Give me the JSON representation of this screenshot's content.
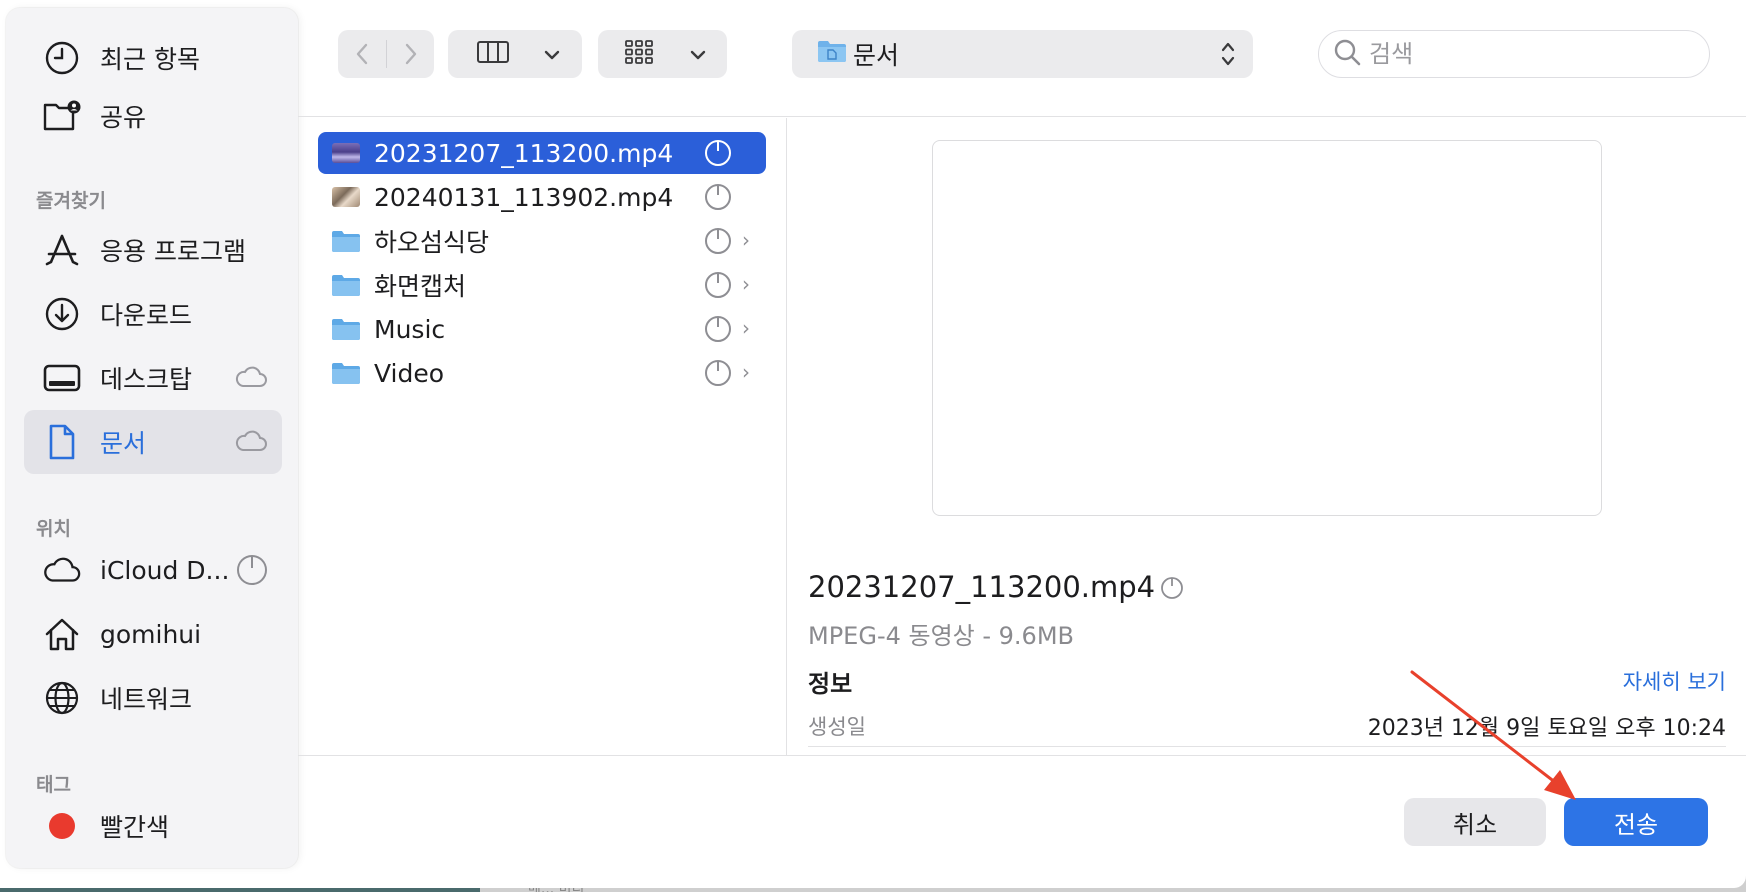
{
  "sidebar": {
    "recent": "최근 항목",
    "shared": "공유",
    "favorites_header": "즐겨찾기",
    "favorites": [
      {
        "label": "응용 프로그램"
      },
      {
        "label": "다운로드"
      },
      {
        "label": "데스크탑"
      },
      {
        "label": "문서"
      }
    ],
    "locations_header": "위치",
    "locations": [
      {
        "label": "iCloud D..."
      },
      {
        "label": "gomihui"
      },
      {
        "label": "네트워크"
      }
    ],
    "tags_header": "태그",
    "tags": [
      {
        "label": "빨간색",
        "color": "#e93a2e"
      }
    ]
  },
  "toolbar": {
    "location": "문서",
    "search_placeholder": "검색"
  },
  "files": [
    {
      "name": "20231207_113200.mp4",
      "kind": "video",
      "selected": true
    },
    {
      "name": "20240131_113902.mp4",
      "kind": "video",
      "selected": false
    },
    {
      "name": "하오섬식당",
      "kind": "folder",
      "selected": false
    },
    {
      "name": "화면캡처",
      "kind": "folder",
      "selected": false
    },
    {
      "name": "Music",
      "kind": "folder",
      "selected": false
    },
    {
      "name": "Video",
      "kind": "folder",
      "selected": false
    }
  ],
  "preview": {
    "title": "20231207_113200.mp4",
    "subtitle": "MPEG-4 동영상 - 9.6MB",
    "info_header": "정보",
    "more_link": "자세히 보기",
    "created_label": "생성일",
    "created_value": "2023년 12월 9일 토요일 오후 10:24"
  },
  "buttons": {
    "cancel": "취소",
    "send": "전송"
  },
  "background_text": "메... 미디",
  "colors": {
    "accent": "#2b5fd9",
    "send_button": "#2d74e6",
    "annotation_arrow": "#e8412c"
  }
}
